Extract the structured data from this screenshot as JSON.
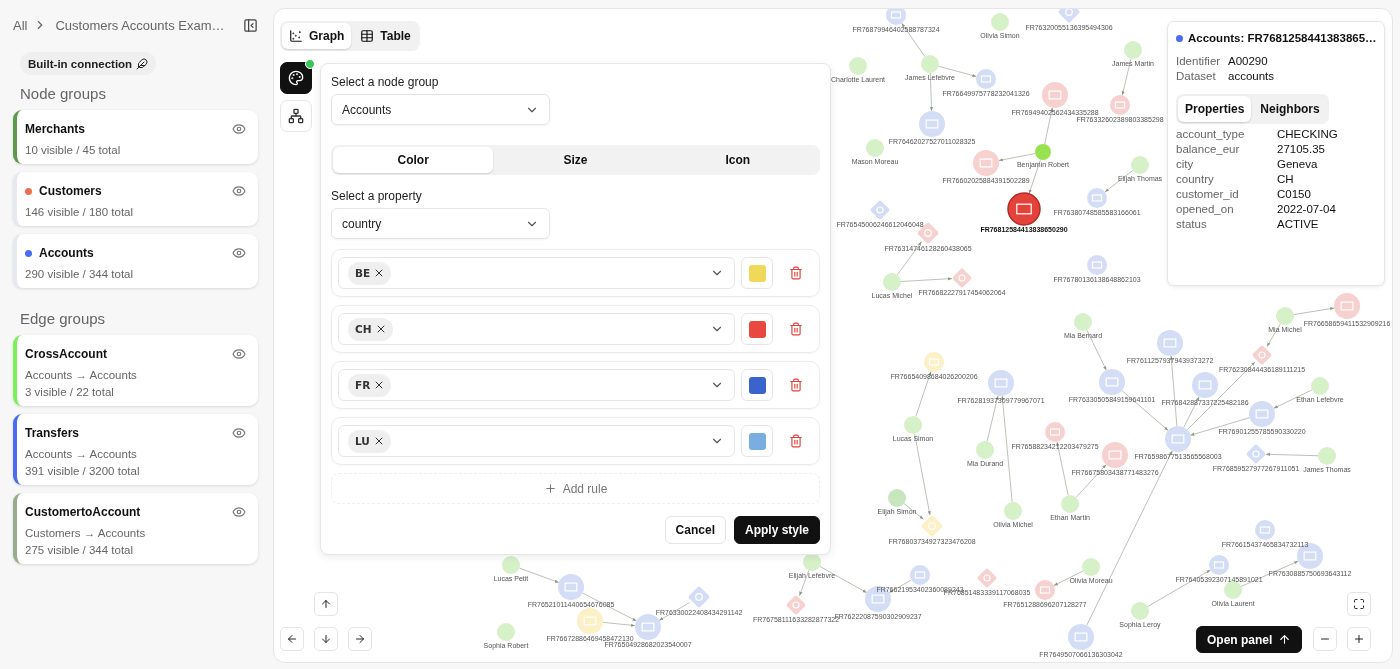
{
  "breadcrumb": {
    "root": "All",
    "current": "Customers Accounts Exam…"
  },
  "connection": "Built-in connection",
  "node_groups": {
    "heading": "Node groups",
    "items": [
      {
        "name": "Merchants",
        "stats": "10 visible / 45 total",
        "kind": "bar",
        "color": "#5e9a4c"
      },
      {
        "name": "Customers",
        "stats": "146 visible / 180 total",
        "kind": "dot",
        "color": "#ec6f4d"
      },
      {
        "name": "Accounts",
        "stats": "290 visible / 344 total",
        "kind": "dot",
        "color": "#4a6cf0"
      }
    ]
  },
  "edge_groups": {
    "heading": "Edge groups",
    "items": [
      {
        "name": "CrossAccount",
        "route": "Accounts → Accounts",
        "stats": "3 visible / 22 total",
        "color": "#7cf05a"
      },
      {
        "name": "Transfers",
        "route": "Accounts → Accounts",
        "stats": "391 visible / 3200 total",
        "color": "#4a6cf0"
      },
      {
        "name": "CustomertoAccount",
        "route": "Customers → Accounts",
        "stats": "275 visible / 344 total",
        "color": "#98ad8c"
      }
    ]
  },
  "view_tabs": [
    {
      "label": "Graph",
      "selected": true
    },
    {
      "label": "Table",
      "selected": false
    }
  ],
  "tools": [
    {
      "kind": "palette",
      "selected": true,
      "badge": true
    },
    {
      "kind": "network",
      "selected": false
    }
  ],
  "style_panel": {
    "group_label": "Select a node group",
    "group_value": "Accounts",
    "tabs": [
      {
        "label": "Color",
        "selected": true
      },
      {
        "label": "Size",
        "selected": false
      },
      {
        "label": "Icon",
        "selected": false
      }
    ],
    "property_label": "Select a property",
    "property_value": "country",
    "rules": [
      {
        "value": "BE",
        "color": "#f0d858"
      },
      {
        "value": "CH",
        "color": "#e8483f"
      },
      {
        "value": "FR",
        "color": "#3a63cc"
      },
      {
        "value": "LU",
        "color": "#7aaee0"
      }
    ],
    "add_rule": "Add rule",
    "cancel": "Cancel",
    "apply": "Apply style"
  },
  "details": {
    "color": "#4a6cf0",
    "title": "Accounts: FR7681258441383865…",
    "meta": [
      {
        "label": "Identifier",
        "value": "A00290"
      },
      {
        "label": "Dataset",
        "value": "accounts"
      }
    ],
    "tabs": [
      {
        "label": "Properties",
        "selected": true
      },
      {
        "label": "Neighbors",
        "selected": false
      }
    ],
    "properties": [
      {
        "key": "account_type",
        "value": "CHECKING"
      },
      {
        "key": "balance_eur",
        "value": "27105.35"
      },
      {
        "key": "city",
        "value": "Geneva"
      },
      {
        "key": "country",
        "value": "CH"
      },
      {
        "key": "customer_id",
        "value": "C0150"
      },
      {
        "key": "opened_on",
        "value": "2022-07-04"
      },
      {
        "key": "status",
        "value": "ACTIVE"
      }
    ]
  },
  "graph": {
    "nodes": [
      {
        "label": "FR76879946402588787324",
        "kind": "account",
        "color": "#d4ddf6",
        "selected": false
      },
      {
        "label": "Olivia Simon",
        "kind": "customer",
        "color": "#d6f0c8",
        "selected": false
      },
      {
        "label": "FR76320055136395494306",
        "kind": "merchant",
        "color": "#d4ddf6",
        "selected": false
      },
      {
        "label": "Charlotte Laurent",
        "kind": "customer",
        "color": "#d6f0c8",
        "selected": false
      },
      {
        "label": "James Lefebvre",
        "kind": "customer",
        "color": "#d6f0c8",
        "selected": false
      },
      {
        "label": "FR76649975778232041326",
        "kind": "account",
        "color": "#d4ddf6",
        "selected": false
      },
      {
        "label": "FR76462027527011028325",
        "kind": "account",
        "color": "#d4ddf6",
        "selected": false
      },
      {
        "label": "Mason Moreau",
        "kind": "customer",
        "color": "#d6f0c8",
        "selected": false
      },
      {
        "label": "FR76949402562434335288",
        "kind": "account",
        "color": "#f7d0d0",
        "selected": false
      },
      {
        "label": "Benjamin Robert",
        "kind": "customer",
        "color": "#98e252",
        "selected": false
      },
      {
        "label": "FR76602025884391502289",
        "kind": "account",
        "color": "#f7d0d0",
        "selected": false
      },
      {
        "label": "FR76812584413838650290",
        "kind": "account",
        "color": "#e3433b",
        "selected": true
      },
      {
        "label": "James Martin",
        "kind": "customer",
        "color": "#d6f0c8",
        "selected": false
      },
      {
        "label": "FR76332602389803385298",
        "kind": "account",
        "color": "#f7d0d0",
        "selected": false
      },
      {
        "label": "Elijah Thomas",
        "kind": "customer",
        "color": "#d6f0c8",
        "selected": false
      },
      {
        "label": "FR76380748585583166061",
        "kind": "account",
        "color": "#d4ddf6",
        "selected": false
      },
      {
        "label": "FR76545006246612046048",
        "kind": "merchant",
        "color": "#d4ddf6",
        "selected": false
      },
      {
        "label": "FR76314746128260438065",
        "kind": "merchant",
        "color": "#f7d0d0",
        "selected": false
      },
      {
        "label": "Lucas Michel",
        "kind": "customer",
        "color": "#d6f0c8",
        "selected": false
      },
      {
        "label": "FR76682227917454062064",
        "kind": "merchant",
        "color": "#f7d0d0",
        "selected": false
      },
      {
        "label": "FR76780136138648862103",
        "kind": "account",
        "color": "#d4ddf6",
        "selected": false
      },
      {
        "label": "Mia Bernard",
        "kind": "customer",
        "color": "#d6f0c8",
        "selected": false
      },
      {
        "label": "FR76330505849159641101",
        "kind": "account",
        "color": "#d4ddf6",
        "selected": false
      },
      {
        "label": "FR76112579379439373272",
        "kind": "account",
        "color": "#d4ddf6",
        "selected": false
      },
      {
        "label": "FR76842887337225482186",
        "kind": "account",
        "color": "#d4ddf6",
        "selected": false
      },
      {
        "label": "Mia Michel",
        "kind": "customer",
        "color": "#d6f0c8",
        "selected": false
      },
      {
        "label": "FR76230844436189111215",
        "kind": "merchant",
        "color": "#f7d0d0",
        "selected": false
      },
      {
        "label": "FR76658659411532909216",
        "kind": "account",
        "color": "#f7d0d0",
        "selected": false
      },
      {
        "label": "Ethan Lefebvre",
        "kind": "customer",
        "color": "#d6f0c8",
        "selected": false
      },
      {
        "label": "FR76901255785590330220",
        "kind": "account",
        "color": "#d4ddf6",
        "selected": false
      },
      {
        "label": "FR76598677513565568003",
        "kind": "account",
        "color": "#d4ddf6",
        "selected": false
      },
      {
        "label": "FR76859527977267911051",
        "kind": "merchant",
        "color": "#d4ddf6",
        "selected": false
      },
      {
        "label": "James Thomas",
        "kind": "customer",
        "color": "#d6f0c8",
        "selected": false
      },
      {
        "label": "FR76281937309779967071",
        "kind": "account",
        "color": "#d4ddf6",
        "selected": false
      },
      {
        "label": "FR76654098684026200206",
        "kind": "account",
        "color": "#fcf0c6",
        "selected": false
      },
      {
        "label": "Lucas Simon",
        "kind": "customer",
        "color": "#d6f0c8",
        "selected": false
      },
      {
        "label": "Mia Durand",
        "kind": "customer",
        "color": "#d6f0c8",
        "selected": false
      },
      {
        "label": "FR76588234212203479275",
        "kind": "account",
        "color": "#f7d0d0",
        "selected": false
      },
      {
        "label": "FR76675803438771483276",
        "kind": "account",
        "color": "#f7d0d0",
        "selected": false
      },
      {
        "label": "Ethan Martin",
        "kind": "customer",
        "color": "#d6f0c8",
        "selected": false
      },
      {
        "label": "Elijah Simon",
        "kind": "customer",
        "color": "#c8e6bd",
        "selected": false
      },
      {
        "label": "FR76803734927323476208",
        "kind": "merchant",
        "color": "#fcf0c6",
        "selected": false
      },
      {
        "label": "Olivia Michel",
        "kind": "customer",
        "color": "#d6f0c8",
        "selected": false
      },
      {
        "label": "FR76615437465834732113",
        "kind": "account",
        "color": "#d4ddf6",
        "selected": false
      },
      {
        "label": "Lucas Petit",
        "kind": "customer",
        "color": "#d6f0c8",
        "selected": false
      },
      {
        "label": "FR76521011440654676085",
        "kind": "account",
        "color": "#d4ddf6",
        "selected": false
      },
      {
        "label": "Sophia Robert",
        "kind": "customer",
        "color": "#d6f0c8",
        "selected": false
      },
      {
        "label": "FR76504928682023540007",
        "kind": "account",
        "color": "#d4ddf6",
        "selected": false
      },
      {
        "label": "FR76672886469458472130",
        "kind": "account",
        "color": "#fcf0c6",
        "selected": false
      },
      {
        "label": "FR76330022408434291142",
        "kind": "merchant",
        "color": "#d4ddf6",
        "selected": false
      },
      {
        "label": "Elijah Lefebvre",
        "kind": "customer",
        "color": "#d6f0c8",
        "selected": false
      },
      {
        "label": "FR76758111633282877322",
        "kind": "merchant",
        "color": "#f7d0d0",
        "selected": false
      },
      {
        "label": "FR76222087590302909237",
        "kind": "account",
        "color": "#d4ddf6",
        "selected": false
      },
      {
        "label": "FR76621953402360089243",
        "kind": "account",
        "color": "#d4ddf6",
        "selected": false
      },
      {
        "label": "FR76851483339117068035",
        "kind": "merchant",
        "color": "#f7d0d0",
        "selected": false
      },
      {
        "label": "FR7651288696207128277",
        "kind": "account",
        "color": "#f7d0d0",
        "selected": false
      },
      {
        "label": "Olivia Moreau",
        "kind": "customer",
        "color": "#d6f0c8",
        "selected": false
      },
      {
        "label": "Sophia Leroy",
        "kind": "customer",
        "color": "#d6f0c8",
        "selected": false
      },
      {
        "label": "Olivia Laurent",
        "kind": "customer",
        "color": "#d6f0c8",
        "selected": false
      },
      {
        "label": "FR7649507066136303042",
        "kind": "account",
        "color": "#d4ddf6",
        "selected": false
      },
      {
        "label": "FR76405392307145891021",
        "kind": "account",
        "color": "#d4ddf6",
        "selected": false
      },
      {
        "label": "FR7630885750693643112",
        "kind": "account",
        "color": "#d4ddf6",
        "selected": false
      }
    ]
  },
  "open_panel": "Open panel"
}
